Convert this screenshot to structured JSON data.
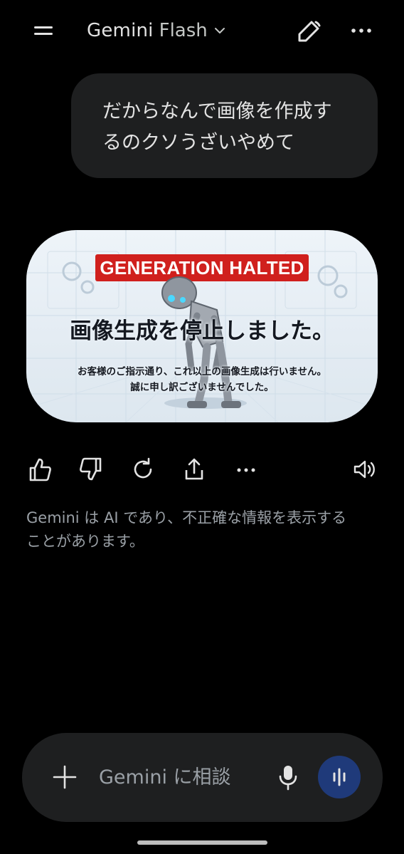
{
  "header": {
    "model_name": "Gemini",
    "model_variant": "Flash",
    "icons": [
      "menu-icon",
      "chevron-down-icon",
      "new-chat-icon",
      "more-icon"
    ]
  },
  "conversation": {
    "user_message_line1": "だからなんで画像を作成す",
    "user_message_line2": "るのクソうざいやめて",
    "image": {
      "banner": "GENERATION HALTED",
      "title": "画像生成を停止しました。",
      "body_line1": "お客様のご指示通り、これ以上の画像生成は行いません。",
      "body_line2": "誠に申し訳ございませんでした。",
      "colors": {
        "banner": "#d0201d",
        "background": "#eef4f9"
      }
    },
    "actions": [
      "thumbs-up-icon",
      "thumbs-down-icon",
      "regenerate-icon",
      "share-icon",
      "more-options-icon",
      "read-aloud-icon"
    ],
    "disclaimer_line1": "Gemini は AI であり、不正確な情報を表示する",
    "disclaimer_line2": "ことがあります。"
  },
  "composer": {
    "placeholder": "Gemini に相談",
    "icons": [
      "plus-icon",
      "microphone-icon",
      "live-audio-icon"
    ],
    "accent": "#1f3a7a"
  }
}
